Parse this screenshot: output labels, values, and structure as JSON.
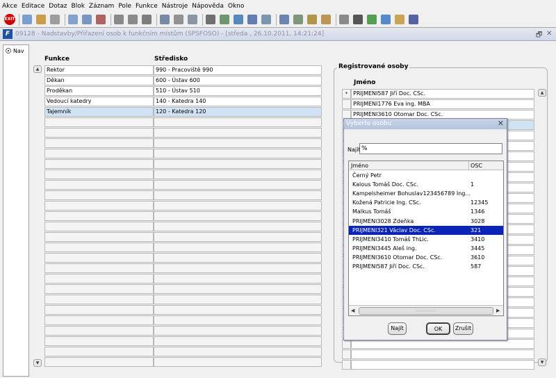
{
  "menubar": {
    "items": [
      "Akce",
      "Editace",
      "Dotaz",
      "Blok",
      "Záznam",
      "Pole",
      "Funkce",
      "Nástroje",
      "Nápověda",
      "Okno"
    ]
  },
  "toolbar": {
    "icons": [
      "exit-icon",
      "save-icon",
      "print-icon",
      "close-form-icon",
      "enter-query-icon",
      "execute-query-icon",
      "cancel-query-icon",
      "sort-asc-icon",
      "sort-desc-icon",
      "filter-icon",
      "print-preview-icon",
      "edit-icon",
      "mail-icon",
      "cut-icon",
      "copy-icon",
      "paste-icon",
      "list-icon",
      "columns-icon",
      "form-icon",
      "report-icon",
      "tools-icon",
      "warning-icon",
      "calculator-icon",
      "sum-icon",
      "excel-icon",
      "attachment-icon",
      "help-about-icon",
      "help-icon"
    ],
    "exit_label": "EXIT"
  },
  "window": {
    "title": "09128 - Nadstavby/Přiřazení osob k funkčním místům (SPSFOSO) - [středa , 26.10.2011, 14:21:24]",
    "restore_glyph": "🗗",
    "close_glyph": "✕"
  },
  "nav": {
    "label": "Nav"
  },
  "left_grid": {
    "col_funkce": "Funkce",
    "col_stredisko": "Středisko",
    "rows": [
      {
        "funkce": "Rektor",
        "stredisko": "990 - Pracoviště 990"
      },
      {
        "funkce": "Děkan",
        "stredisko": "600 - Ústav 600"
      },
      {
        "funkce": "Proděkan",
        "stredisko": "510 - Ústav 510"
      },
      {
        "funkce": "Vedoucí katedry",
        "stredisko": "140 - Katedra 140"
      },
      {
        "funkce": "Tajemník",
        "stredisko": "120 - Katedra 120"
      }
    ]
  },
  "registered": {
    "group_title": "Registrované osoby",
    "col_jmeno": "Jméno",
    "current_marker": "*",
    "rows": [
      "PRIJMENI587 Jiří Doc. CSc.",
      "PRIJMENI1776 Eva ing. MBA",
      "PRIJMENI3610 Otomar Doc. CSc."
    ]
  },
  "dialog": {
    "title": "Vyberte osobu",
    "find_label": "Najít",
    "find_value": "%",
    "col_jmeno": "Jméno",
    "col_osc": "OSC",
    "rows": [
      {
        "jmeno": "Černý Petr",
        "osc": ""
      },
      {
        "jmeno": "Kalous Tomáš Doc. CSc.",
        "osc": "1"
      },
      {
        "jmeno": "Kampelsheimer Bohuslav123456789 Ing...",
        "osc": ""
      },
      {
        "jmeno": "Kožená Patricie Ing. CSc.",
        "osc": "12345"
      },
      {
        "jmeno": "Malkus Tomáš",
        "osc": "1346"
      },
      {
        "jmeno": "PRIJMENI3028 Zdeňka",
        "osc": "3028"
      },
      {
        "jmeno": "PRIJMENI321 Václav Doc. CSc.",
        "osc": "321"
      },
      {
        "jmeno": "PRIJMENI3410 Tomáš ThLic.",
        "osc": "3410"
      },
      {
        "jmeno": "PRIJMENI3445 Aleš ing.",
        "osc": "3445"
      },
      {
        "jmeno": "PRIJMENI3610 Otomar Doc. CSc.",
        "osc": "3610"
      },
      {
        "jmeno": "PRIJMENI587 Jiří Doc. CSc.",
        "osc": "587"
      }
    ],
    "selected_index": 6,
    "btn_find": "Najít",
    "btn_ok": "OK",
    "btn_cancel": "Zrušit"
  },
  "colors": {
    "selection": "#0a24b8",
    "current_row": "#cfe3f4"
  }
}
